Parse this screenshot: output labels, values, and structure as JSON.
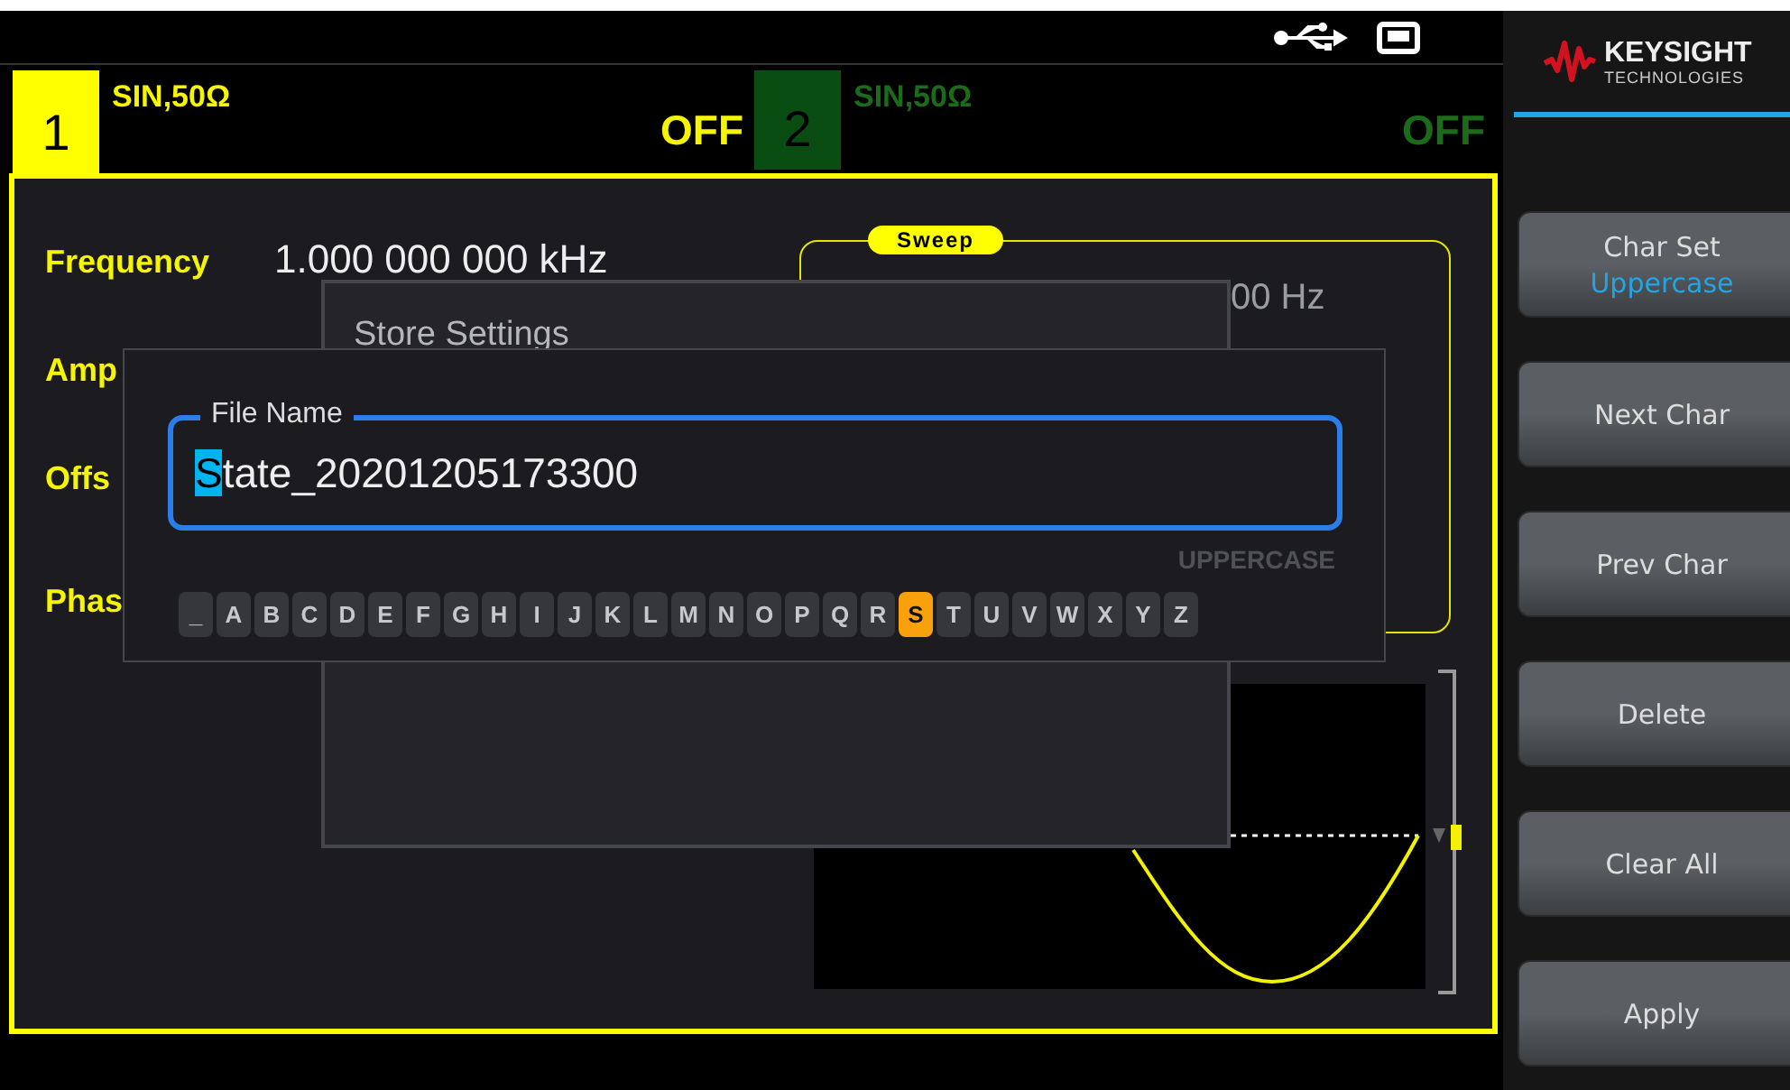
{
  "channels": [
    {
      "number": "1",
      "signal": "SIN,50Ω",
      "output": "OFF",
      "selected": true
    },
    {
      "number": "2",
      "signal": "SIN,50Ω",
      "output": "OFF",
      "selected": false
    }
  ],
  "parameters": [
    {
      "label": "Frequency",
      "value": "1.000 000 000 kHz"
    },
    {
      "label": "Amp"
    },
    {
      "label": "Offs"
    },
    {
      "label": "Phas"
    }
  ],
  "sweep_panel": {
    "title": "Sweep",
    "value": "00 Hz"
  },
  "store_dialog": {
    "title": "Store Settings"
  },
  "file_name_dialog": {
    "field_label": "File Name",
    "cursor_char": "S",
    "after_cursor": "tate_20201205173300",
    "charset": "UPPERCASE",
    "keys": [
      {
        "char": "_",
        "selected": false
      },
      {
        "char": "A",
        "selected": false
      },
      {
        "char": "B",
        "selected": false
      },
      {
        "char": "C",
        "selected": false
      },
      {
        "char": "D",
        "selected": false
      },
      {
        "char": "E",
        "selected": false
      },
      {
        "char": "F",
        "selected": false
      },
      {
        "char": "G",
        "selected": false
      },
      {
        "char": "H",
        "selected": false
      },
      {
        "char": "I",
        "selected": false
      },
      {
        "char": "J",
        "selected": false
      },
      {
        "char": "K",
        "selected": false
      },
      {
        "char": "L",
        "selected": false
      },
      {
        "char": "M",
        "selected": false
      },
      {
        "char": "N",
        "selected": false
      },
      {
        "char": "O",
        "selected": false
      },
      {
        "char": "P",
        "selected": false
      },
      {
        "char": "Q",
        "selected": false
      },
      {
        "char": "R",
        "selected": false
      },
      {
        "char": "S",
        "selected": true
      },
      {
        "char": "T",
        "selected": false
      },
      {
        "char": "U",
        "selected": false
      },
      {
        "char": "V",
        "selected": false
      },
      {
        "char": "W",
        "selected": false
      },
      {
        "char": "X",
        "selected": false
      },
      {
        "char": "Y",
        "selected": false
      },
      {
        "char": "Z",
        "selected": false
      }
    ]
  },
  "logo": {
    "brand": "KEYSIGHT",
    "subtitle": "TECHNOLOGIES"
  },
  "softkeys": [
    {
      "label": "Char Set",
      "value": "Uppercase"
    },
    {
      "label": "Next Char"
    },
    {
      "label": "Prev Char"
    },
    {
      "label": "Delete"
    },
    {
      "label": "Clear All"
    },
    {
      "label": "Apply"
    }
  ]
}
